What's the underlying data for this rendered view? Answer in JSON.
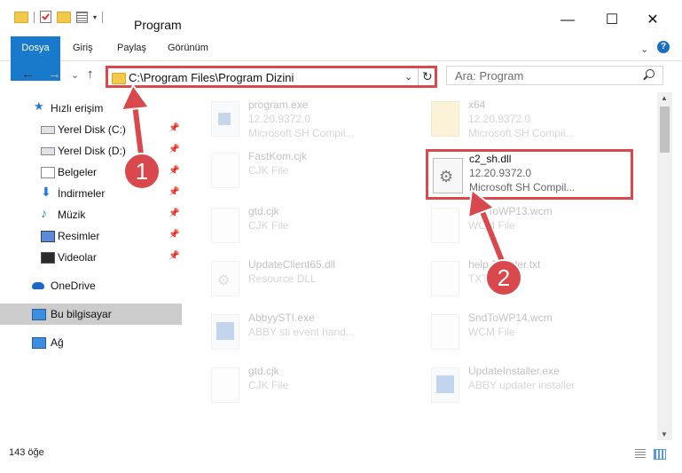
{
  "window": {
    "title": "Program",
    "minimize": "—",
    "maximize": "☐",
    "close": "✕"
  },
  "ribbon": {
    "tabs": [
      "Dosya",
      "Giriş",
      "Paylaş",
      "Görünüm"
    ],
    "chevron": "⌄",
    "help": "?"
  },
  "nav": {
    "back": "←",
    "forward": "→",
    "recent": "⌄",
    "up": "↑",
    "address": "C:\\Program Files\\Program Dizini",
    "address_dropdown": "⌄",
    "refresh": "↻",
    "search_placeholder": "Ara: Program"
  },
  "sidebar": {
    "items": [
      {
        "label": "Hızlı erişim",
        "icon": "star-icon",
        "pinned": false
      },
      {
        "label": "Yerel Disk (C:)",
        "icon": "drive-icon",
        "pinned": true
      },
      {
        "label": "Yerel Disk (D:)",
        "icon": "drive-icon",
        "pinned": true
      },
      {
        "label": "Belgeler",
        "icon": "documents-icon",
        "pinned": true
      },
      {
        "label": "İndirmeler",
        "icon": "downloads-icon",
        "pinned": true
      },
      {
        "label": "Müzik",
        "icon": "music-icon",
        "pinned": true
      },
      {
        "label": "Resimler",
        "icon": "pictures-icon",
        "pinned": true
      },
      {
        "label": "Videolar",
        "icon": "videos-icon",
        "pinned": true
      },
      {
        "label": "OneDrive",
        "icon": "onedrive-icon",
        "pinned": false
      },
      {
        "label": "Bu bilgisayar",
        "icon": "pc-icon",
        "pinned": false,
        "selected": true
      },
      {
        "label": "Ağ",
        "icon": "network-icon",
        "pinned": false
      }
    ],
    "pin_glyph": "📌"
  },
  "files": [
    {
      "name": "program.exe",
      "line2": "12.20.9372.0",
      "line3": "Microsoft SH Compil...",
      "type": "exe"
    },
    {
      "name": "x64",
      "line2": "12.20.9372.0",
      "line3": "Microsoft SH Compil...",
      "type": "folder"
    },
    {
      "name": "FastKom.cjk",
      "line2": "CJK File",
      "line3": "",
      "type": "doc"
    },
    {
      "name": "gtd.cjk",
      "line2": "CJK File",
      "line3": "",
      "type": "doc"
    },
    {
      "name": "SndToWP13.wcm",
      "line2": "WCM File",
      "line3": "",
      "type": "doc"
    },
    {
      "name": "UpdateClient65.dll",
      "line2": "Resource DLL",
      "line3": "",
      "type": "dll"
    },
    {
      "name": "help-Reader.txt",
      "line2": "TXT File",
      "line3": "",
      "type": "doc"
    },
    {
      "name": "AbbyySTI.exe",
      "line2": "ABBY sti event hand...",
      "line3": "",
      "type": "abby"
    },
    {
      "name": "SndToWP14.wcm",
      "line2": "WCM File",
      "line3": "",
      "type": "doc"
    },
    {
      "name": "gtd.cjk",
      "line2": "CJK File",
      "line3": "",
      "type": "doc"
    },
    {
      "name": "UpdateInstaller.exe",
      "line2": "ABBY updater installer",
      "line3": "",
      "type": "abby"
    }
  ],
  "selected_file": {
    "name": "c2_sh.dll",
    "line2": "12.20.9372.0",
    "line3": "Microsoft SH Compil..."
  },
  "status": {
    "count": "143 öğe"
  },
  "callouts": [
    "1",
    "2"
  ],
  "colors": {
    "accent": "#1979ca",
    "highlight": "#d8484d",
    "sidebar_selected": "#cccccc"
  }
}
